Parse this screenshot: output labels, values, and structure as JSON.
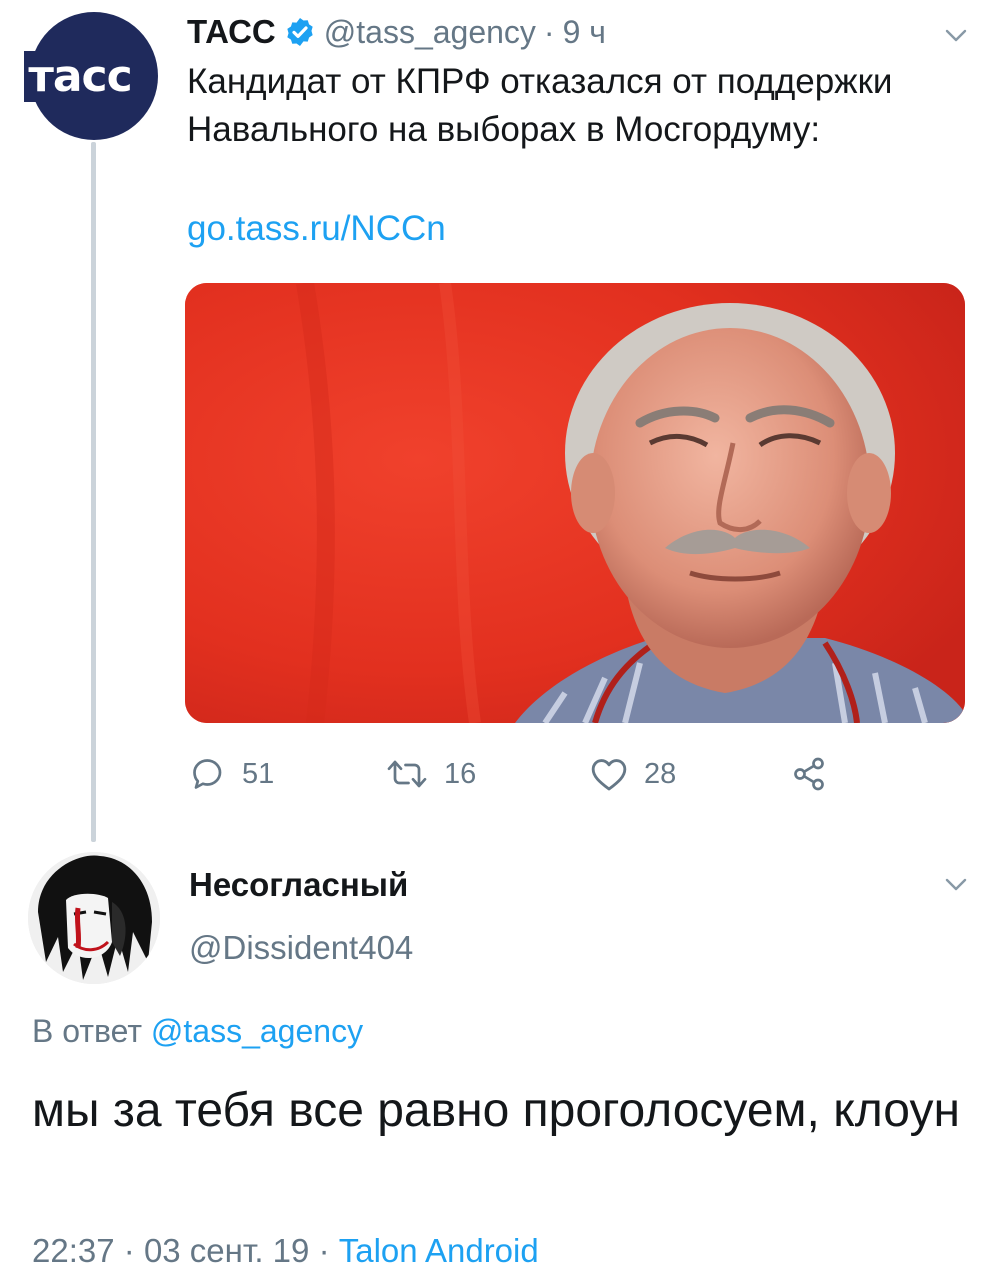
{
  "tweet": {
    "avatar_logo_text": "тасс",
    "author_name": "ТАСС",
    "author_handle": "@tass_agency",
    "separator": "·",
    "time_ago": "9 ч",
    "text": "Кандидат от КПРФ отказался от поддержки Навального на выборах в Мосгордуму:",
    "link": "go.tass.ru/NCCn",
    "actions": {
      "replies": "51",
      "retweets": "16",
      "likes": "28"
    },
    "icons": [
      "verified-icon",
      "chevron-down-icon",
      "reply-icon",
      "retweet-icon",
      "like-icon",
      "share-icon"
    ]
  },
  "reply": {
    "author_name": "Несогласный",
    "author_handle": "@Dissident404",
    "reply_prefix": "В ответ",
    "reply_mention": "@tass_agency",
    "text": "мы за тебя все равно проголосуем, клоун",
    "time": "22:37",
    "separator": "·",
    "date": "03 сент. 19",
    "client": "Talon Android"
  },
  "colors": {
    "link": "#1da1f2",
    "secondary_text": "#657786",
    "primary_text": "#14171a",
    "tass_blue": "#1f2a5c",
    "photo_red": "#e53424"
  }
}
